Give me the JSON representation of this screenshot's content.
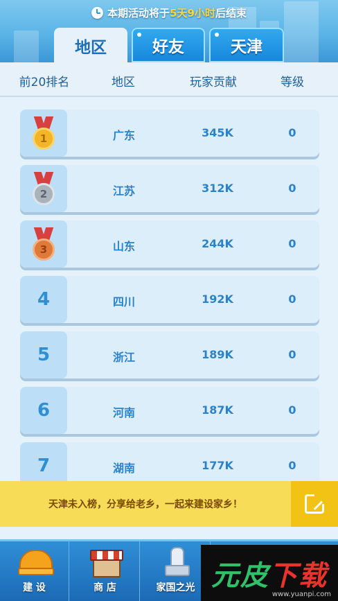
{
  "notice": {
    "prefix": "本期活动将于",
    "highlight": "5天9小时",
    "suffix": "后结束"
  },
  "tabs": [
    {
      "label": "地区",
      "active": true
    },
    {
      "label": "好友",
      "active": false
    },
    {
      "label": "天津",
      "active": false
    }
  ],
  "columns": {
    "rank": "前20排名",
    "region": "地区",
    "contribution": "玩家贡献",
    "level": "等级"
  },
  "rows": [
    {
      "rank": "1",
      "medal": "gold",
      "region": "广东",
      "contribution": "345K",
      "level": "0"
    },
    {
      "rank": "2",
      "medal": "silver",
      "region": "江苏",
      "contribution": "312K",
      "level": "0"
    },
    {
      "rank": "3",
      "medal": "bronze",
      "region": "山东",
      "contribution": "244K",
      "level": "0"
    },
    {
      "rank": "4",
      "region": "四川",
      "contribution": "192K",
      "level": "0"
    },
    {
      "rank": "5",
      "region": "浙江",
      "contribution": "189K",
      "level": "0"
    },
    {
      "rank": "6",
      "region": "河南",
      "contribution": "187K",
      "level": "0"
    },
    {
      "rank": "7",
      "region": "湖南",
      "contribution": "177K",
      "level": "0"
    }
  ],
  "share": {
    "text": "天津未入榜，分享给老乡，一起来建设家乡！",
    "icon": "share-icon"
  },
  "bottom_nav": [
    {
      "label": "建 设",
      "icon": "helmet-icon"
    },
    {
      "label": "商 店",
      "icon": "shop-icon"
    },
    {
      "label": "家国之光",
      "icon": "rocket-icon"
    }
  ],
  "watermark": {
    "text_1": "元",
    "text_2": "皮",
    "text_3": "下载",
    "url": "www.yuanpi.com"
  },
  "colors": {
    "accent": "#2a83c9",
    "tab_active_text": "#1f6fb6",
    "highlight": "#ffd53d",
    "share_bar": "#f7dc58"
  }
}
